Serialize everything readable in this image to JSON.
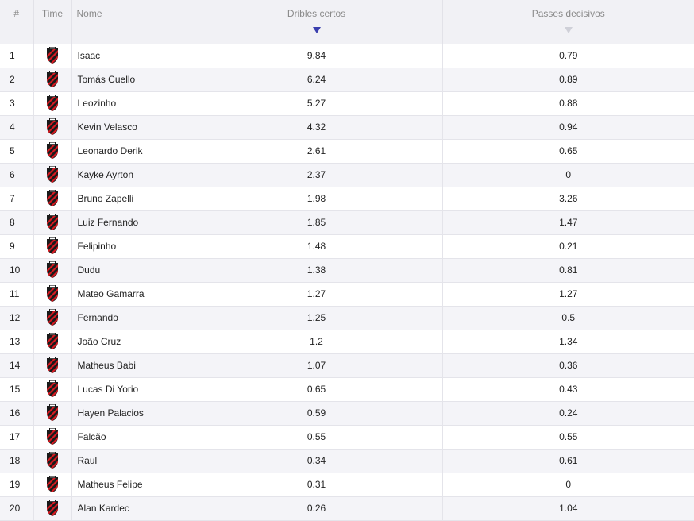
{
  "table": {
    "headers": {
      "rank": "#",
      "team": "Time",
      "name": "Nome",
      "dribbles": "Dribles certos",
      "key_passes": "Passes decisivos"
    },
    "sort": {
      "column": "dribbles",
      "direction": "descending"
    },
    "team_icon": "athletico-paranaense-crest-icon",
    "colors": {
      "crest_red": "#d71920",
      "crest_black": "#1a1a1a",
      "sort_active": "#3a3fae",
      "sort_inactive": "#cfd0d8"
    },
    "rows": [
      {
        "rank": "1",
        "name": "Isaac",
        "dribbles": "9.84",
        "key_passes": "0.79"
      },
      {
        "rank": "2",
        "name": "Tomás Cuello",
        "dribbles": "6.24",
        "key_passes": "0.89"
      },
      {
        "rank": "3",
        "name": "Leozinho",
        "dribbles": "5.27",
        "key_passes": "0.88"
      },
      {
        "rank": "4",
        "name": "Kevin Velasco",
        "dribbles": "4.32",
        "key_passes": "0.94"
      },
      {
        "rank": "5",
        "name": "Leonardo Derik",
        "dribbles": "2.61",
        "key_passes": "0.65"
      },
      {
        "rank": "6",
        "name": "Kayke Ayrton",
        "dribbles": "2.37",
        "key_passes": "0"
      },
      {
        "rank": "7",
        "name": "Bruno Zapelli",
        "dribbles": "1.98",
        "key_passes": "3.26"
      },
      {
        "rank": "8",
        "name": "Luiz Fernando",
        "dribbles": "1.85",
        "key_passes": "1.47"
      },
      {
        "rank": "9",
        "name": "Felipinho",
        "dribbles": "1.48",
        "key_passes": "0.21"
      },
      {
        "rank": "10",
        "name": "Dudu",
        "dribbles": "1.38",
        "key_passes": "0.81"
      },
      {
        "rank": "11",
        "name": "Mateo Gamarra",
        "dribbles": "1.27",
        "key_passes": "1.27"
      },
      {
        "rank": "12",
        "name": "Fernando",
        "dribbles": "1.25",
        "key_passes": "0.5"
      },
      {
        "rank": "13",
        "name": "João Cruz",
        "dribbles": "1.2",
        "key_passes": "1.34"
      },
      {
        "rank": "14",
        "name": "Matheus Babi",
        "dribbles": "1.07",
        "key_passes": "0.36"
      },
      {
        "rank": "15",
        "name": "Lucas Di Yorio",
        "dribbles": "0.65",
        "key_passes": "0.43"
      },
      {
        "rank": "16",
        "name": "Hayen Palacios",
        "dribbles": "0.59",
        "key_passes": "0.24"
      },
      {
        "rank": "17",
        "name": "Falcão",
        "dribbles": "0.55",
        "key_passes": "0.55"
      },
      {
        "rank": "18",
        "name": "Raul",
        "dribbles": "0.34",
        "key_passes": "0.61"
      },
      {
        "rank": "19",
        "name": "Matheus Felipe",
        "dribbles": "0.31",
        "key_passes": "0"
      },
      {
        "rank": "20",
        "name": "Alan Kardec",
        "dribbles": "0.26",
        "key_passes": "1.04"
      }
    ]
  }
}
